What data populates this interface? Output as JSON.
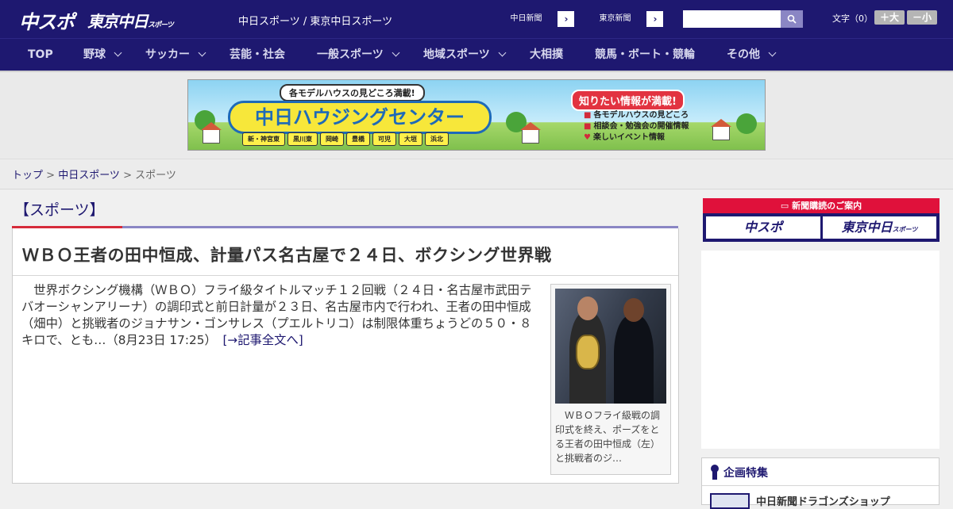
{
  "header": {
    "logo_chuspo": "中スポ",
    "logo_tokyo": "東京中日",
    "logo_tokyo_sub": "スポーツ",
    "site_links": "中日スポーツ / 東京中日スポーツ",
    "ext_links": [
      {
        "label": "中日新聞"
      },
      {
        "label": "東京新聞"
      }
    ],
    "search": {
      "placeholder": "",
      "value": ""
    },
    "font_size_label": "文字（0）",
    "font_larger": "＋大",
    "font_smaller": "－小"
  },
  "nav": {
    "items": [
      {
        "label": "TOP"
      },
      {
        "label": "野球"
      },
      {
        "label": "サッカー"
      },
      {
        "label": "芸能・社会"
      },
      {
        "label": "一般スポーツ"
      },
      {
        "label": "地域スポーツ"
      },
      {
        "label": "大相撲"
      },
      {
        "label": "競馬・ボート・競輪"
      },
      {
        "label": "その他"
      }
    ]
  },
  "banner": {
    "top_line": "各モデルハウスの見どころ満載!",
    "main": "中日ハウジングセンター",
    "towns": [
      "新・神宮東",
      "黒川東",
      "岡崎",
      "豊橋",
      "可児",
      "大垣",
      "浜北"
    ],
    "right_title": "知りたい情報が満載!",
    "right_list": [
      "各モデルハウスの見どころ",
      "相談会・勉強会の開催情報",
      "楽しいイベント情報"
    ]
  },
  "breadcrumb": {
    "home": "トップ",
    "sep1": " > ",
    "section": "中日スポーツ",
    "sep2": " > ",
    "current": "スポーツ"
  },
  "section_title": "【スポーツ】",
  "article": {
    "headline": "ＷＢＯ王者の田中恒成、計量パス名古屋で２４日、ボクシング世界戦",
    "body": "世界ボクシング機構（ＷＢＯ）フライ級タイトルマッチ１２回戦（２４日・名古屋市武田テバオーシャンアリーナ）の調印式と前日計量が２３日、名古屋市内で行われ、王者の田中恒成（畑中）と挑戦者のジョナサン・ゴンサレス（プエルトリコ）は制限体重ちょうどの５０・８キロで、とも…（8月23日 17:25）",
    "read_more": "[→記事全文へ]",
    "photo_caption": "ＷＢＯフライ級戦の調印式を終え、ポーズをとる王者の田中恒成（左）と挑戦者のジ…"
  },
  "sidebar": {
    "subscribe_head": "新聞購読のご案内",
    "sub_chuspo": "中スポ",
    "sub_tokyo": "東京中日",
    "sub_tokyo_small": "スポーツ",
    "feature_title": "企画特集",
    "feature_item": "中日新聞ドラゴンズショップ"
  },
  "colors": {
    "navy": "#1e1870",
    "accent_red": "#d62b3a",
    "purple_rule": "#8a86c4"
  }
}
